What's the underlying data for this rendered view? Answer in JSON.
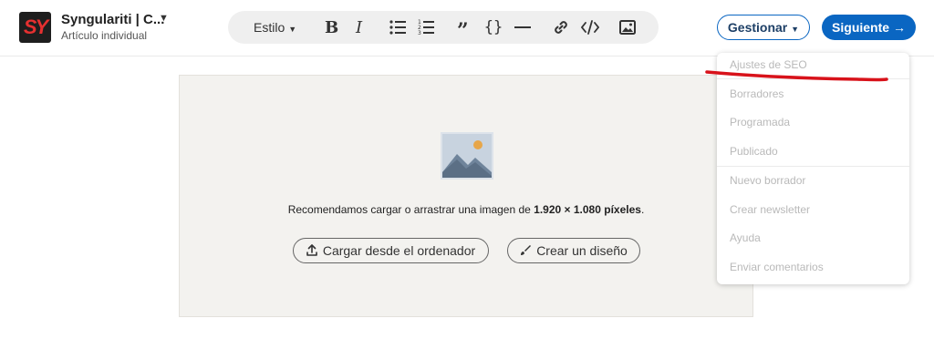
{
  "header": {
    "logo_text": "SY",
    "brand_name": "Syngulariti | C...",
    "brand_subtitle": "Artículo individual"
  },
  "toolbar": {
    "style_label": "Estilo",
    "icons": [
      "bold-icon",
      "italic-icon",
      "bullet-list-icon",
      "numbered-list-icon",
      "quote-icon",
      "code-block-icon",
      "divider-icon",
      "link-icon",
      "embed-code-icon",
      "image-icon"
    ]
  },
  "actions": {
    "manage_label": "Gestionar",
    "next_label": "Siguiente"
  },
  "upload": {
    "recommend_prefix": "Recomendamos cargar o arrastrar una imagen de ",
    "recommend_size": "1.920 × 1.080 píxeles",
    "recommend_suffix": ".",
    "upload_button": "Cargar desde el ordenador",
    "design_button": "Crear un diseño"
  },
  "dropdown": {
    "items": [
      "Ajustes de SEO",
      "Borradores",
      "Programada",
      "Publicado",
      "Nuevo borrador",
      "Crear newsletter",
      "Ayuda",
      "Enviar comentarios"
    ]
  },
  "colors": {
    "accent": "#0a66c2",
    "annotation": "#d8121a",
    "upload_bg": "#f3f2ef"
  }
}
